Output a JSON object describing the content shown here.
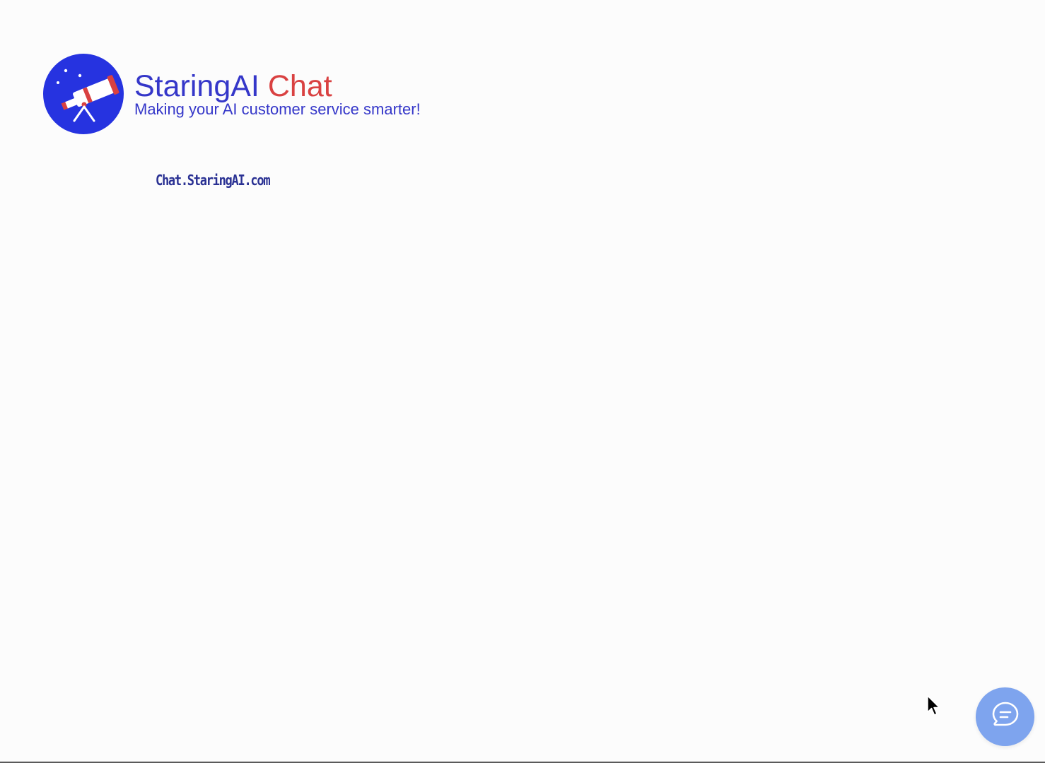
{
  "brand": {
    "logo_icon": "telescope-logo-icon",
    "title_primary": "StaringAI",
    "title_accent": "Chat",
    "tagline": "Making your AI customer service smarter!"
  },
  "site_link": {
    "label": "Chat.StaringAI.com"
  },
  "chat_widget": {
    "icon": "chat-bubble-icon"
  },
  "colors": {
    "brand_blue": "#3537c9",
    "brand_red": "#d94141",
    "logo_bg": "#2633e0",
    "fab_bg": "#7ea4ee"
  }
}
